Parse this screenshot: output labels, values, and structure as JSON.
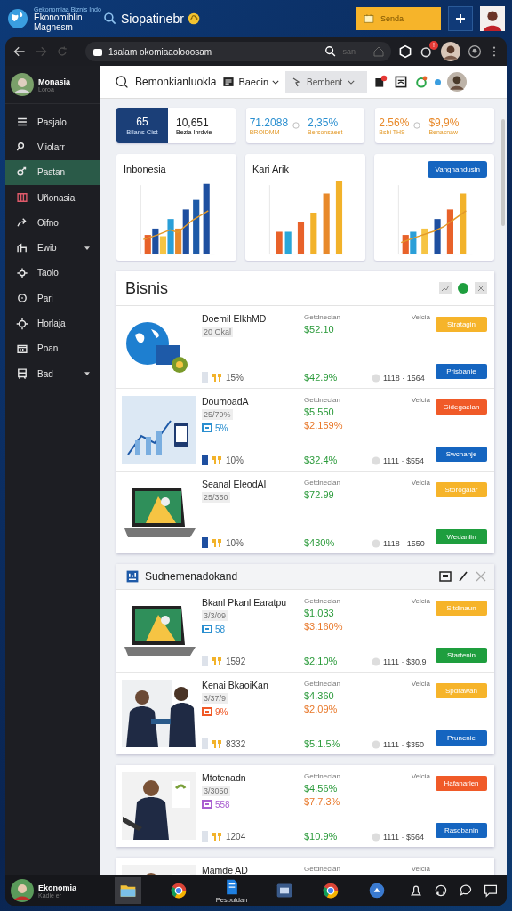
{
  "topbar": {
    "tagline": "Gekonomiaa Biznis Indo",
    "logo_line1": "Ekonomiblin",
    "logo_line2": "Magnesm",
    "search_label": "Siopatinebr",
    "action_button": "Senda"
  },
  "browser": {
    "url": "1salam okomiaaolooosam",
    "find_hint": "san",
    "badge": "!"
  },
  "sidebar": {
    "profile_name": "Monasia",
    "profile_sub": "Loroa",
    "items": [
      {
        "label": "Pasjalo",
        "selected": false,
        "expandable": false
      },
      {
        "label": "Viiolarr",
        "selected": false,
        "expandable": false
      },
      {
        "label": "Pastan",
        "selected": true,
        "expandable": false
      },
      {
        "label": "Uñonasia",
        "selected": false,
        "expandable": false
      },
      {
        "label": "Oifno",
        "selected": false,
        "expandable": false
      },
      {
        "label": "Ewib",
        "selected": false,
        "expandable": true
      },
      {
        "label": "Taolo",
        "selected": false,
        "expandable": false
      },
      {
        "label": "Pari",
        "selected": false,
        "expandable": false
      },
      {
        "label": "Horlaja",
        "selected": false,
        "expandable": false
      },
      {
        "label": "Poan",
        "selected": false,
        "expandable": false
      },
      {
        "label": "Bad",
        "selected": false,
        "expandable": true
      }
    ]
  },
  "header": {
    "search": "Bemonkianluokla",
    "menu": "Baecin",
    "select": "Bembent"
  },
  "stats": [
    {
      "highlight_value": "65",
      "highlight_label": "Bilans Cist",
      "value": "10,651",
      "label": "Bezia Inrdvie"
    },
    {
      "value": "71.2088",
      "label": "BROIDMM",
      "value2": "2,35%",
      "label2": "Bersonsaeet",
      "color": "#2a8fd0"
    },
    {
      "value": "2.56%",
      "label": "Bsbi THS",
      "value2": "$9,9%",
      "label2": "Benasnaw",
      "color": "#e8892a"
    }
  ],
  "charts": [
    {
      "title": "Inbonesia"
    },
    {
      "title": "Kari Arik"
    },
    {
      "button": "Vangnandusin"
    }
  ],
  "sections": [
    {
      "title": "Bisnis",
      "kind": "plain",
      "rows": [
        {
          "title": "Doemil ElkhMD",
          "code": "20 Okal",
          "label": "Getdnecian",
          "label2": "Velcia",
          "price": "$52.10",
          "rating": "15%",
          "marker": {
            "color": "#dde2ea"
          },
          "total": "$42.9%",
          "stat": "1118 · 1564",
          "button": {
            "label": "Stratagin",
            "color": "#f6b42a"
          },
          "button2": {
            "label": "Prisbanie",
            "color": "#1565c0"
          }
        },
        {
          "title": "DoumoadA",
          "code": "25/79%",
          "tag": {
            "text": "5%",
            "color": "#2a8fd0"
          },
          "label": "Getdnecian",
          "label2": "Velcia",
          "price": "$5.550",
          "change": "$2.159%",
          "rating": "10%",
          "marker": {
            "color": "#1e4fa0"
          },
          "total": "$32.4%",
          "stat": "1111 · $554",
          "button": {
            "label": "Gidegaelan",
            "color": "#f05a28"
          },
          "button2": {
            "label": "Swchanje",
            "color": "#1565c0"
          }
        },
        {
          "title": "Seanal EleodAI",
          "code": "25/350",
          "label": "Getdnecian",
          "label2": "Velcia",
          "price": "$72.99",
          "rating": "10%",
          "marker": {
            "color": "#1e4fa0"
          },
          "total": "$430%",
          "stat": "1118 · 1550",
          "button": {
            "label": "Storogalar",
            "color": "#f6b42a"
          },
          "button2": {
            "label": "Wedanlin",
            "color": "#1e9e3e"
          }
        }
      ]
    },
    {
      "title": "Sudnemenadokand",
      "kind": "window",
      "rows": [
        {
          "title": "Bkanl Pkanl Earatpu",
          "code": "3/3/09",
          "tag": {
            "text": "58",
            "color": "#2a8fd0"
          },
          "label": "Getdnecian",
          "label2": "Velcia",
          "price": "$1.033",
          "change": "$3.160%",
          "rating": "1592",
          "marker": {
            "color": "#dde2ea"
          },
          "total": "$2.10%",
          "stat": "1111 · $30.9",
          "button": {
            "label": "Sitdinaun",
            "color": "#f6b42a"
          },
          "button2": {
            "label": "Startenin",
            "color": "#1e9e3e"
          }
        },
        {
          "title": "Kenai BkaoiKan",
          "code": "3/37/9",
          "tag": {
            "text": "9%",
            "color": "#f05a28"
          },
          "label": "Getdnecian",
          "label2": "Velcia",
          "price": "$4.360",
          "change": "$2.09%",
          "rating": "8332",
          "marker": {
            "color": "#dde2ea"
          },
          "total": "$5.1.5%",
          "stat": "1111 · $350",
          "button": {
            "label": "Spdrawan",
            "color": "#f6b42a"
          },
          "button2": {
            "label": "Prunenie",
            "color": "#1565c0"
          }
        }
      ]
    },
    {
      "kind": "card",
      "rows": [
        {
          "title": "Mtotenadn",
          "code": "3/3050",
          "tag": {
            "text": "558",
            "color": "#a95fd0"
          },
          "label": "Getdnecian",
          "label2": "Velcia",
          "price": "$4.56%",
          "change": "$7.7.3%",
          "rating": "1204",
          "marker": {
            "color": "#dde2ea"
          },
          "total": "$10.9%",
          "stat": "1111 · $564",
          "button": {
            "label": "Hafanarlen",
            "color": "#f05a28"
          },
          "button2": {
            "label": "Rasobanin",
            "color": "#1565c0"
          }
        }
      ]
    },
    {
      "kind": "card",
      "rows": [
        {
          "title": "Mamde AD",
          "label": "Getdnecian",
          "label2": "Velcia"
        }
      ]
    }
  ],
  "taskbar": {
    "user_name": "Ekonomia",
    "user_sub": "Kadie er",
    "app_label": "Pesbuldan"
  }
}
